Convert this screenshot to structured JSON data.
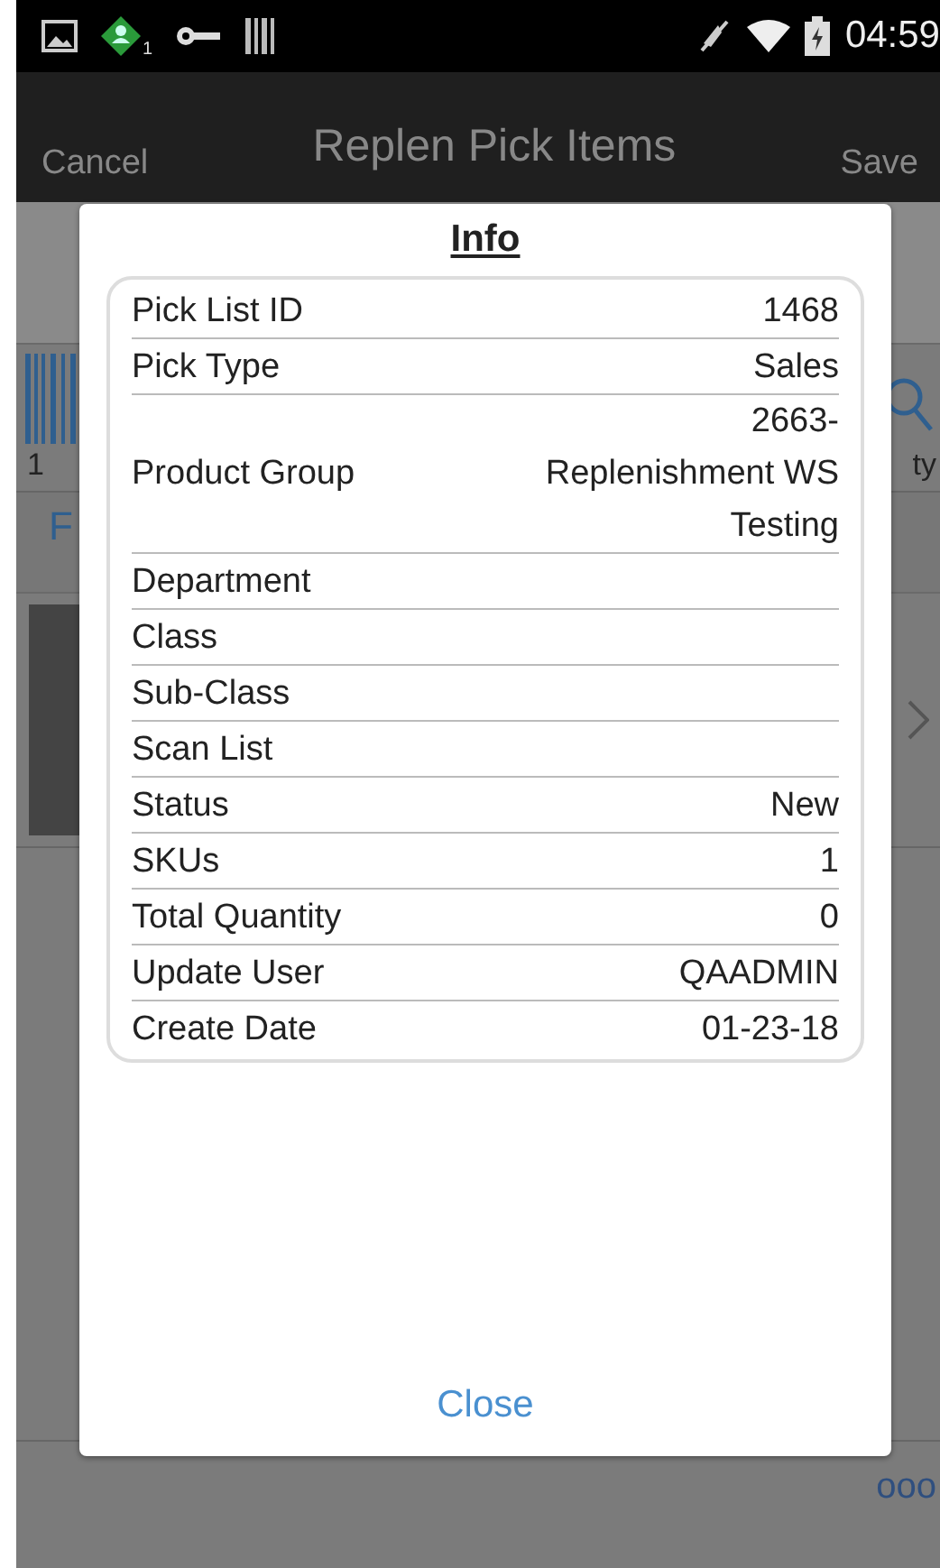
{
  "status_bar": {
    "notification_count": "1",
    "time": "04:59"
  },
  "toolbar": {
    "cancel": "Cancel",
    "title": "Replen Pick Items",
    "save": "Save"
  },
  "background": {
    "scan_count": "1",
    "tab_fragment": "F",
    "column_fragment": "ty",
    "more": "ooo"
  },
  "dialog": {
    "title": "Info",
    "rows": [
      {
        "label": "Pick List ID",
        "value": "1468"
      },
      {
        "label": "Pick Type",
        "value": "Sales"
      },
      {
        "label": "Product Group",
        "value": "2663- Replenishment WS Testing"
      },
      {
        "label": "Department"
      },
      {
        "label": "Class"
      },
      {
        "label": "Sub-Class"
      },
      {
        "label": "Scan List"
      },
      {
        "label": "Status",
        "value": "New"
      },
      {
        "label": "SKUs",
        "value": "1"
      },
      {
        "label": "Total Quantity",
        "value": "0"
      },
      {
        "label": "Update User",
        "value": "QAADMIN"
      },
      {
        "label": "Create Date",
        "value": "01-23-18"
      }
    ],
    "close": "Close"
  }
}
